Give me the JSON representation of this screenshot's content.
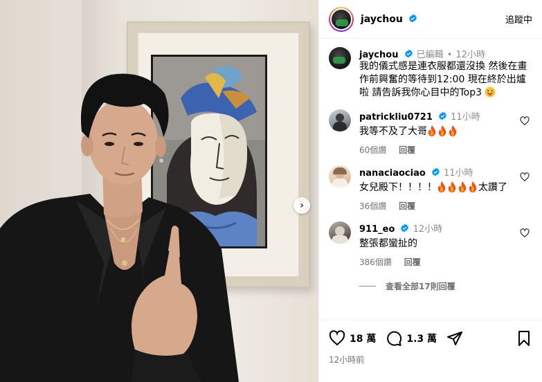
{
  "photo": {
    "description_icon": "next-arrow-icon",
    "next_label": "›"
  },
  "header": {
    "username": "jaychou",
    "follow_state": "追蹤中"
  },
  "caption": {
    "username": "jaychou",
    "edited": "已編輯",
    "dot": "•",
    "time": "12小時",
    "text": "我的儀式感是連衣服都還沒換 然後在畫作前興奮的等待到12:00  現在終於出爐啦 請告訴我你心目中的Top3"
  },
  "comments": [
    {
      "username": "patrickliu0721",
      "time": "11小時",
      "text": "我等不及了大哥",
      "fires": 3,
      "likes": "60個讚",
      "reply": "回覆"
    },
    {
      "username": "nanaciaociao",
      "time": "11小時",
      "text_before": "女兒殿下！！！！",
      "fires": 4,
      "text_after": "太讚了",
      "likes": "36個讚",
      "reply": "回覆"
    },
    {
      "username": "911_eo",
      "time": "12小時",
      "text": "整張都蠻扯的",
      "likes": "386個讚",
      "reply": "回覆"
    }
  ],
  "view_all": "查看全部17則回覆",
  "actions": {
    "likes": "18 萬",
    "comments": "1.3 萬"
  },
  "post_time": "12小時前",
  "colors": {
    "verified": "#0095f6",
    "grey": "#737373",
    "fire": "#f4511e"
  }
}
